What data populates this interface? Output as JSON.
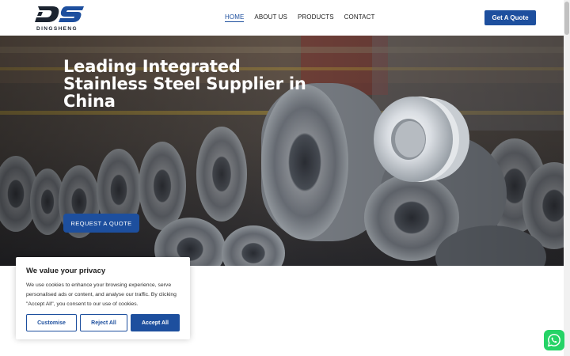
{
  "brand": {
    "logo_text": "DS",
    "name": "DINGSHENG"
  },
  "nav": {
    "items": [
      {
        "label": "HOME",
        "active": true
      },
      {
        "label": "ABOUT US",
        "active": false
      },
      {
        "label": "PRODUCTS",
        "active": false
      },
      {
        "label": "CONTACT",
        "active": false
      }
    ],
    "cta_label": "Get A Quote"
  },
  "hero": {
    "title": "Leading Integrated Stainless Steel Supplier in China",
    "button_label": "REQUEST A QUOTE"
  },
  "cookie": {
    "title": "We value your privacy",
    "text": "We use cookies to enhance your browsing experience, serve personalised ads or content, and analyse our traffic. By clicking \"Accept All\", you consent to our use of cookies.",
    "customise_label": "Customise",
    "reject_label": "Reject All",
    "accept_label": "Accept All"
  },
  "colors": {
    "accent": "#1d4f9e",
    "whatsapp": "#25d366"
  },
  "icons": {
    "whatsapp": "whatsapp-icon"
  }
}
